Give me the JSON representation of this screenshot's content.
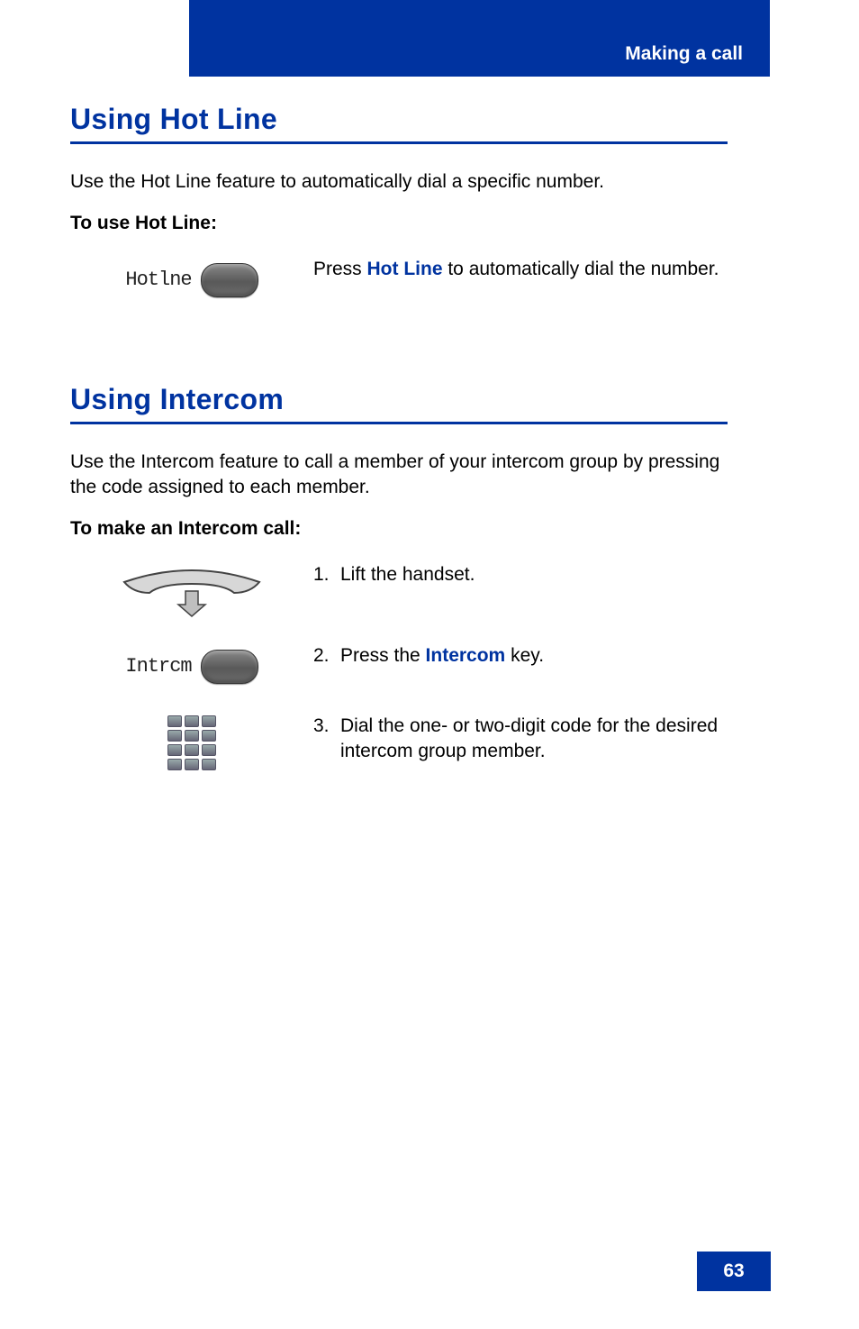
{
  "header": {
    "title": "Making a call"
  },
  "section1": {
    "heading": "Using Hot Line",
    "intro": "Use the Hot Line feature to automatically dial a specific number.",
    "subhead": "To use Hot Line:",
    "button_label": "Hotlne",
    "press_pre": "Press ",
    "press_emph": "Hot Line",
    "press_post": " to automatically dial the number."
  },
  "section2": {
    "heading": "Using Intercom",
    "intro": "Use the Intercom feature to call a member of your intercom group by pressing the code assigned to each member.",
    "subhead": "To make an Intercom call:",
    "button_label": "Intrcm",
    "step1_num": "1.",
    "step1_text": "Lift the handset.",
    "step2_num": "2.",
    "step2_pre": "Press the ",
    "step2_emph": "Intercom",
    "step2_post": " key.",
    "step3_num": "3.",
    "step3_text": "Dial the one- or two-digit code for the desired intercom group member."
  },
  "footer": {
    "page": "63"
  }
}
